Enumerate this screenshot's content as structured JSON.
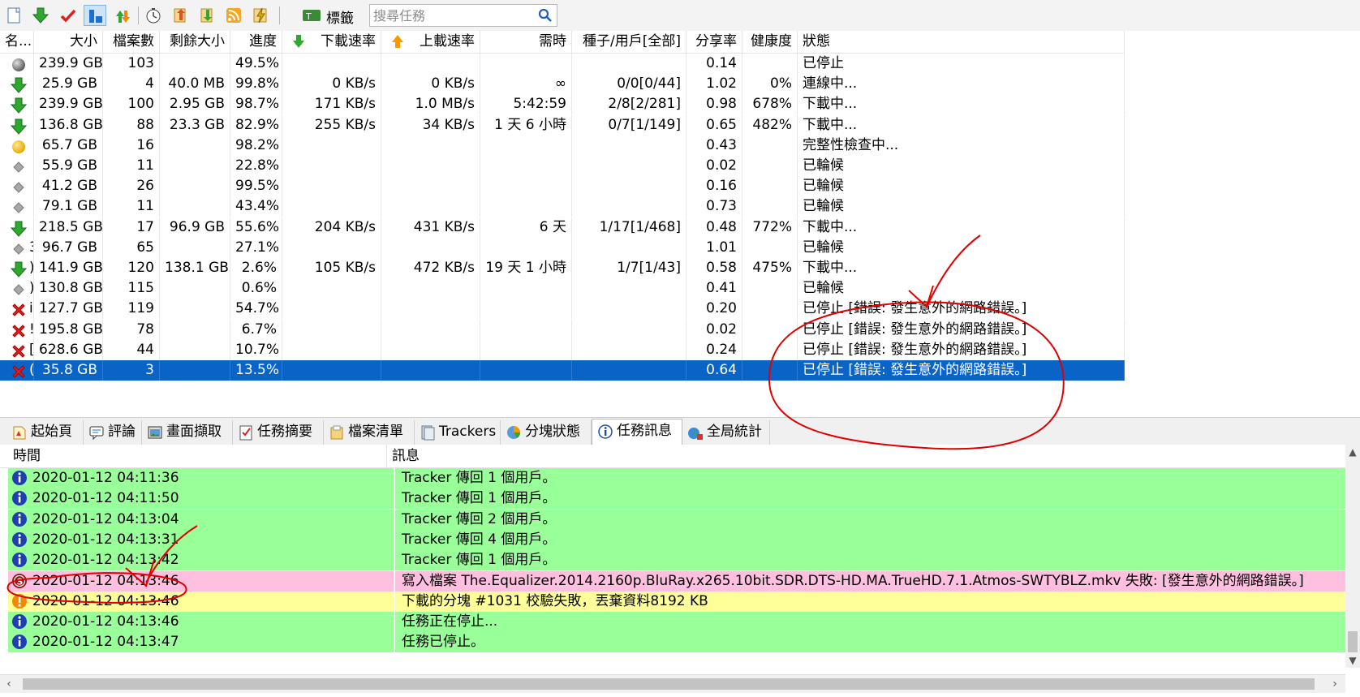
{
  "toolbar": {
    "buttons": [
      {
        "name": "new-task-icon"
      },
      {
        "name": "download-icon"
      },
      {
        "name": "checkmark-icon"
      },
      {
        "name": "layout-icon"
      },
      {
        "name": "sort-updown-icon"
      },
      {
        "name": "timer-icon"
      },
      {
        "name": "move-up-icon"
      },
      {
        "name": "move-down-icon"
      },
      {
        "name": "rss-icon"
      },
      {
        "name": "speed-limit-icon"
      }
    ],
    "tag_label": "標籤",
    "search_placeholder": "搜尋任務"
  },
  "columns": {
    "name": "名...",
    "size": "大小",
    "files": "檔案數",
    "remaining": "剩餘大小",
    "progress": "進度",
    "down_speed": "下載速率",
    "up_speed": "上載速率",
    "eta": "需時",
    "seeds": "種子/用戶[全部]",
    "ratio": "分享率",
    "health": "健康度",
    "status": "狀態"
  },
  "torrents": [
    {
      "icon": "stopped",
      "name": "",
      "size": "239.9 GB",
      "files": "103",
      "remaining": "",
      "progress": "49.5%",
      "down": "",
      "up": "",
      "eta": "",
      "seeds": "",
      "ratio": "0.14",
      "health": "",
      "status": "已停止"
    },
    {
      "icon": "download",
      "name": "",
      "size": "25.9 GB",
      "files": "4",
      "remaining": "40.0 MB",
      "progress": "99.8%",
      "down": "0 KB/s",
      "up": "0 KB/s",
      "eta": "∞",
      "seeds": "0/0[0/44]",
      "ratio": "1.02",
      "health": "0%",
      "status": "連線中..."
    },
    {
      "icon": "download",
      "name": "",
      "size": "239.9 GB",
      "files": "100",
      "remaining": "2.95 GB",
      "progress": "98.7%",
      "down": "171 KB/s",
      "up": "1.0 MB/s",
      "eta": "5:42:59",
      "seeds": "2/8[2/281]",
      "ratio": "0.98",
      "health": "678%",
      "status": "下載中..."
    },
    {
      "icon": "download",
      "name": "",
      "size": "136.8 GB",
      "files": "88",
      "remaining": "23.3 GB",
      "progress": "82.9%",
      "down": "255 KB/s",
      "up": "34 KB/s",
      "eta": "1 天 6 小時",
      "seeds": "0/7[1/149]",
      "ratio": "0.65",
      "health": "482%",
      "status": "下載中..."
    },
    {
      "icon": "checking",
      "name": "",
      "size": "65.7 GB",
      "files": "16",
      "remaining": "",
      "progress": "98.2%",
      "down": "",
      "up": "",
      "eta": "",
      "seeds": "",
      "ratio": "0.43",
      "health": "",
      "status": "完整性檢查中..."
    },
    {
      "icon": "queued",
      "name": "",
      "size": "55.9 GB",
      "files": "11",
      "remaining": "",
      "progress": "22.8%",
      "down": "",
      "up": "",
      "eta": "",
      "seeds": "",
      "ratio": "0.02",
      "health": "",
      "status": "已輪候"
    },
    {
      "icon": "queued",
      "name": "",
      "size": "41.2 GB",
      "files": "26",
      "remaining": "",
      "progress": "99.5%",
      "down": "",
      "up": "",
      "eta": "",
      "seeds": "",
      "ratio": "0.16",
      "health": "",
      "status": "已輪候"
    },
    {
      "icon": "queued",
      "name": "",
      "size": "79.1 GB",
      "files": "11",
      "remaining": "",
      "progress": "43.4%",
      "down": "",
      "up": "",
      "eta": "",
      "seeds": "",
      "ratio": "0.73",
      "health": "",
      "status": "已輪候"
    },
    {
      "icon": "download",
      "name": "",
      "size": "218.5 GB",
      "files": "17",
      "remaining": "96.9 GB",
      "progress": "55.6%",
      "down": "204 KB/s",
      "up": "431 KB/s",
      "eta": "6 天",
      "seeds": "1/17[1/468]",
      "ratio": "0.48",
      "health": "772%",
      "status": "下載中..."
    },
    {
      "icon": "queued",
      "name": "3",
      "size": "96.7 GB",
      "files": "65",
      "remaining": "",
      "progress": "27.1%",
      "down": "",
      "up": "",
      "eta": "",
      "seeds": "",
      "ratio": "1.01",
      "health": "",
      "status": "已輪候"
    },
    {
      "icon": "download",
      "name": ")",
      "size": "141.9 GB",
      "files": "120",
      "remaining": "138.1 GB",
      "progress": "2.6%",
      "down": "105 KB/s",
      "up": "472 KB/s",
      "eta": "19 天 1 小時",
      "seeds": "1/7[1/43]",
      "ratio": "0.58",
      "health": "475%",
      "status": "下載中..."
    },
    {
      "icon": "queued",
      "name": ")",
      "size": "130.8 GB",
      "files": "115",
      "remaining": "",
      "progress": "0.6%",
      "down": "",
      "up": "",
      "eta": "",
      "seeds": "",
      "ratio": "0.41",
      "health": "",
      "status": "已輪候"
    },
    {
      "icon": "error",
      "name": "i",
      "size": "127.7 GB",
      "files": "119",
      "remaining": "",
      "progress": "54.7%",
      "down": "",
      "up": "",
      "eta": "",
      "seeds": "",
      "ratio": "0.20",
      "health": "",
      "status": "已停止 [錯誤: 發生意外的網路錯誤。]"
    },
    {
      "icon": "error",
      "name": "!",
      "size": "195.8 GB",
      "files": "78",
      "remaining": "",
      "progress": "6.7%",
      "down": "",
      "up": "",
      "eta": "",
      "seeds": "",
      "ratio": "0.02",
      "health": "",
      "status": "已停止 [錯誤: 發生意外的網路錯誤。]"
    },
    {
      "icon": "error",
      "name": "[",
      "size": "628.6 GB",
      "files": "44",
      "remaining": "",
      "progress": "10.7%",
      "down": "",
      "up": "",
      "eta": "",
      "seeds": "",
      "ratio": "0.24",
      "health": "",
      "status": "已停止 [錯誤: 發生意外的網路錯誤。]"
    },
    {
      "icon": "error",
      "name": "(",
      "size": "35.8 GB",
      "files": "3",
      "remaining": "",
      "progress": "13.5%",
      "down": "",
      "up": "",
      "eta": "",
      "seeds": "",
      "ratio": "0.64",
      "health": "",
      "status": "已停止 [錯誤: 發生意外的網路錯誤。]",
      "selected": true
    }
  ],
  "tabs": [
    {
      "label": "起始頁",
      "icon": "home-page-icon"
    },
    {
      "label": "評論",
      "icon": "comment-icon"
    },
    {
      "label": "畫面擷取",
      "icon": "screenshot-icon"
    },
    {
      "label": "任務摘要",
      "icon": "task-summary-icon"
    },
    {
      "label": "檔案清單",
      "icon": "file-list-icon"
    },
    {
      "label": "Trackers",
      "icon": "trackers-icon"
    },
    {
      "label": "分塊狀態",
      "icon": "pie-chart-icon"
    },
    {
      "label": "任務訊息",
      "icon": "info-icon",
      "active": true
    },
    {
      "label": "全局統計",
      "icon": "global-stats-icon"
    }
  ],
  "log": {
    "columns": {
      "time": "時間",
      "message": "訊息"
    },
    "entries": [
      {
        "type": "info",
        "time": "2020-01-12 04:11:36",
        "message": "Tracker 傳回 1 個用戶。"
      },
      {
        "type": "info",
        "time": "2020-01-12 04:11:50",
        "message": "Tracker 傳回 1 個用戶。"
      },
      {
        "type": "info",
        "time": "2020-01-12 04:13:04",
        "message": "Tracker 傳回 2 個用戶。"
      },
      {
        "type": "info",
        "time": "2020-01-12 04:13:31",
        "message": "Tracker 傳回 4 個用戶。"
      },
      {
        "type": "info",
        "time": "2020-01-12 04:13:42",
        "message": "Tracker 傳回 1 個用戶。"
      },
      {
        "type": "error",
        "time": "2020-01-12 04:13:46",
        "message": "寫入檔案 The.Equalizer.2014.2160p.BluRay.x265.10bit.SDR.DTS-HD.MA.TrueHD.7.1.Atmos-SWTYBLZ.mkv 失敗: [發生意外的網路錯誤。]"
      },
      {
        "type": "warn",
        "time": "2020-01-12 04:13:46",
        "message": "下載的分塊 #1031 校驗失敗，丟棄資料8192 KB"
      },
      {
        "type": "info",
        "time": "2020-01-12 04:13:46",
        "message": "任務正在停止..."
      },
      {
        "type": "info",
        "time": "2020-01-12 04:13:47",
        "message": "任務已停止。"
      }
    ]
  },
  "colors": {
    "selection": "#0a64c8",
    "log_info": "#99ff99",
    "log_error": "#ffbfdf",
    "log_warn": "#ffff99",
    "annotation": "#e00000"
  }
}
